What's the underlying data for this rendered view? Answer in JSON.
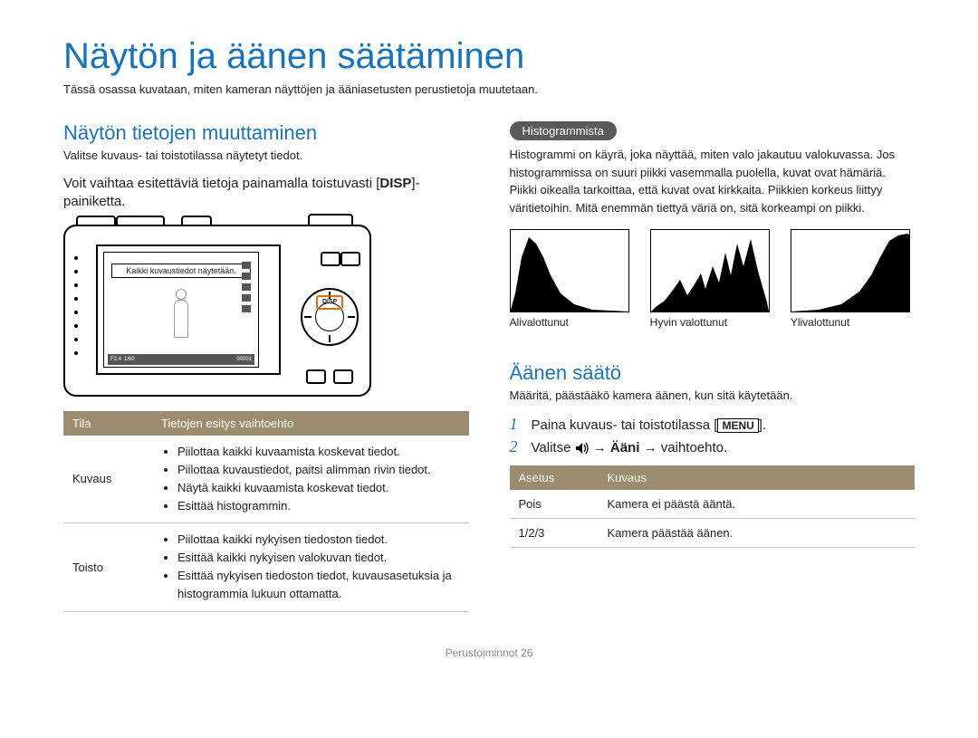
{
  "page": {
    "title": "Näytön ja äänen säätäminen",
    "intro": "Tässä osassa kuvataan, miten kameran näyttöjen ja ääniasetusten perustietoja muutetaan.",
    "footer_section": "Perustoiminnot",
    "footer_page": "26"
  },
  "left": {
    "h2": "Näytön tietojen muuttaminen",
    "sub": "Valitse kuvaus- tai toistotilassa näytetyt tiedot.",
    "instr_a": "Voit vaihtaa esitettäviä tietoja painamalla toistuvasti ",
    "instr_b_bold": "DISP",
    "instr_c": "-painiketta.",
    "camera": {
      "screen_note": "Kaikki kuvaustiedot näytetään.",
      "disp_label": "DISP",
      "bar_f": "F2.4",
      "bar_s": "1/60",
      "bar_counter": "00001"
    },
    "table": {
      "th_mode": "Tila",
      "th_opt": "Tietojen esitys vaihtoehto",
      "rows": [
        {
          "mode": "Kuvaus",
          "items": [
            "Piilottaa kaikki kuvaamista koskevat tiedot.",
            "Piilottaa kuvaustiedot, paitsi alimman rivin tiedot.",
            "Näytä kaikki kuvaamista koskevat tiedot.",
            "Esittää histogrammin."
          ]
        },
        {
          "mode": "Toisto",
          "items": [
            "Piilottaa kaikki nykyisen tiedoston tiedot.",
            "Esittää kaikki nykyisen valokuvan tiedot.",
            "Esittää nykyisen tiedoston tiedot, kuvausasetuksia ja histogrammia lukuun ottamatta."
          ]
        }
      ]
    }
  },
  "right": {
    "pill": "Histogrammista",
    "para": "Histogrammi on käyrä, joka näyttää, miten valo jakautuu valokuvassa. Jos histogrammissa on suuri piikki vasemmalla puolella, kuvat ovat hämäriä. Piikki oikealla tarkoittaa, että kuvat ovat kirkkaita. Piikkien korkeus liittyy väritietoihin. Mitä enemmän tiettyä väriä on, sitä korkeampi on piikki.",
    "histo": {
      "a": "Alivalottunut",
      "b": "Hyvin valottunut",
      "c": "Ylivalottunut"
    },
    "h2_sound": "Äänen säätö",
    "sub_sound": "Määritä, päästääkö kamera äänen, kun sitä käytetään.",
    "steps": {
      "s1_a": "Paina kuvaus- tai toistotilassa ",
      "s1_menu": "MENU",
      "s1_b": ".",
      "s2_a": "Valitse ",
      "s2_arrow1": " → ",
      "s2_bold": "Ääni",
      "s2_arrow2": " → vaihtoehto."
    },
    "sound_table": {
      "th_set": "Asetus",
      "th_desc": "Kuvaus",
      "rows": [
        {
          "set": "Pois",
          "desc": "Kamera ei päästä ääntä."
        },
        {
          "set": "1/2/3",
          "desc": "Kamera päästää äänen."
        }
      ]
    }
  }
}
